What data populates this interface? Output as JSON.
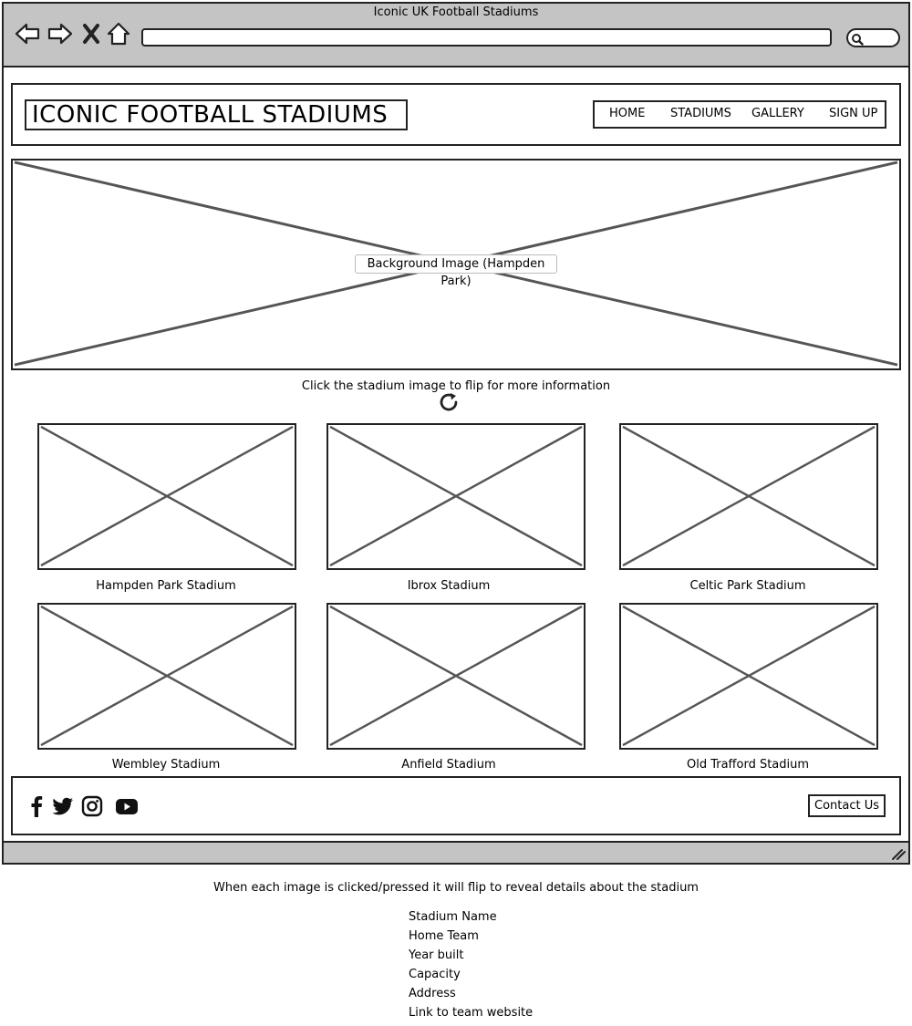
{
  "browser": {
    "window_title": "Iconic UK Football Stadiums",
    "address_value": ""
  },
  "header": {
    "logo": "ICONIC FOOTBALL STADIUMS",
    "nav": [
      "HOME",
      "STADIUMS",
      "GALLERY",
      "SIGN UP"
    ]
  },
  "hero": {
    "label": "Background Image (Hampden Park)"
  },
  "instruction": "Click the stadium image to flip for more information",
  "stadiums": [
    "Hampden Park Stadium",
    "Ibrox Stadium",
    "Celtic Park Stadium",
    "Wembley Stadium",
    "Anfield Stadium",
    "Old Trafford Stadium"
  ],
  "footer": {
    "social_icons": [
      "facebook-icon",
      "twitter-icon",
      "instagram-icon",
      "youtube-icon"
    ],
    "contact_label": "Contact Us"
  },
  "notes": {
    "intro": "When each image is clicked/pressed it will flip to reveal details about the stadium",
    "details": [
      "Stadium Name",
      "Home Team",
      "Year built",
      "Capacity",
      "Address",
      "Link to team website"
    ]
  },
  "colors": {
    "chrome": "#c4c4c4",
    "stroke": "#222222",
    "placeholder_line": "#555555"
  }
}
